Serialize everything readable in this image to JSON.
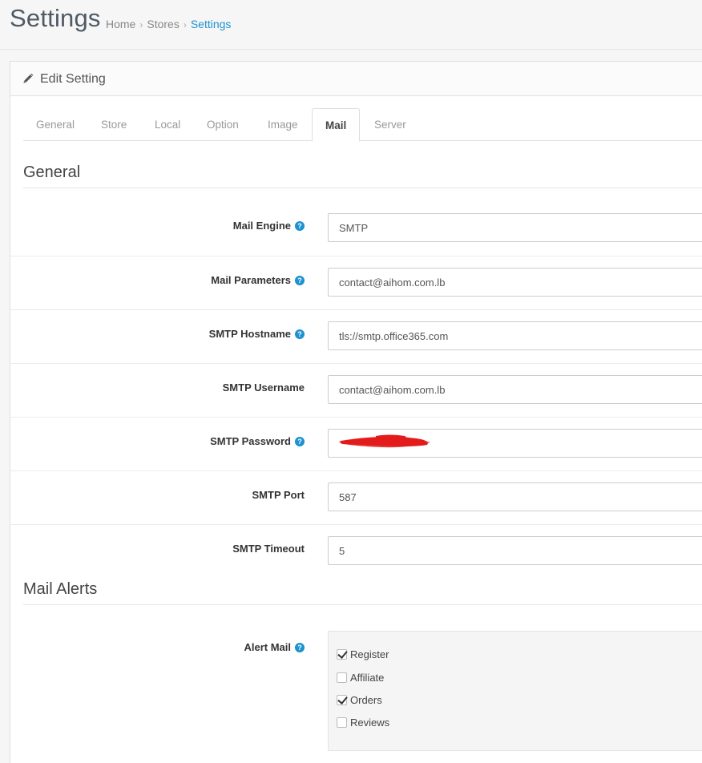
{
  "header": {
    "title": "Settings",
    "breadcrumb": [
      "Home",
      "Stores",
      "Settings"
    ]
  },
  "panel": {
    "title": "Edit Setting",
    "icon": "pencil-icon"
  },
  "tabs": [
    {
      "label": "General",
      "active": false
    },
    {
      "label": "Store",
      "active": false
    },
    {
      "label": "Local",
      "active": false
    },
    {
      "label": "Option",
      "active": false
    },
    {
      "label": "Image",
      "active": false
    },
    {
      "label": "Mail",
      "active": true
    },
    {
      "label": "Server",
      "active": false
    }
  ],
  "sections": {
    "general": "General",
    "alerts": "Mail Alerts"
  },
  "fields": [
    {
      "label": "Mail Engine",
      "value": "SMTP",
      "help": true
    },
    {
      "label": "Mail Parameters",
      "value": "contact@aihom.com.lb",
      "help": true
    },
    {
      "label": "SMTP Hostname",
      "value": "tls://smtp.office365.com",
      "help": true
    },
    {
      "label": "SMTP Username",
      "value": "contact@aihom.com.lb",
      "help": false
    },
    {
      "label": "SMTP Password",
      "value": "",
      "help": true,
      "redacted": true
    },
    {
      "label": "SMTP Port",
      "value": "587",
      "help": false
    },
    {
      "label": "SMTP Timeout",
      "value": "5",
      "help": false
    }
  ],
  "alert_mail": {
    "label": "Alert Mail",
    "options": [
      {
        "label": "Register",
        "checked": true
      },
      {
        "label": "Affiliate",
        "checked": false
      },
      {
        "label": "Orders",
        "checked": true
      },
      {
        "label": "Reviews",
        "checked": false
      }
    ]
  },
  "colors": {
    "accent": "#1e91cf",
    "redaction": "#e31b1b"
  }
}
